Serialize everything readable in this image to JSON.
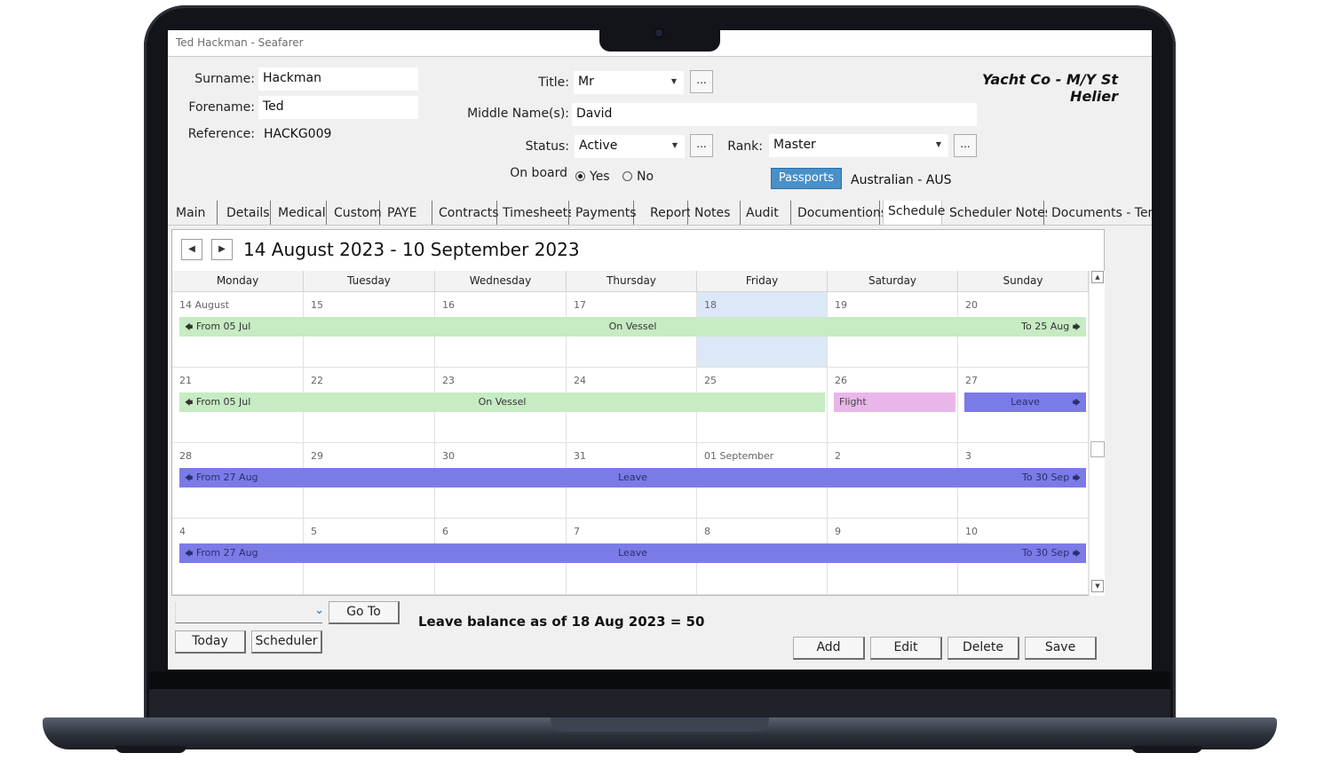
{
  "window": {
    "title": "Ted Hackman - Seafarer"
  },
  "header": {
    "surname_label": "Surname:",
    "surname": "Hackman",
    "forename_label": "Forename:",
    "forename": "Ted",
    "reference_label": "Reference:",
    "reference": "HACKG009",
    "title_label": "Title:",
    "title": "Mr",
    "middle_label": "Middle Name(s):",
    "middle": "David",
    "status_label": "Status:",
    "status": "Active",
    "rank_label": "Rank:",
    "rank": "Master",
    "onboard_label": "On board",
    "yes": "Yes",
    "no": "No",
    "onboard_value": "Yes",
    "company": "Yacht Co - M/Y St Helier",
    "passports_button": "Passports",
    "nationality": "Australian - AUS",
    "ellipsis": "...",
    "dropdown_arrow": "▼"
  },
  "tabs": [
    "Main",
    "Details",
    "Medical",
    "Custom",
    "PAYE",
    "Contracts",
    "Timesheets",
    "Payments",
    "Reports",
    "Notes",
    "Audit",
    "Documentions",
    "Schedule",
    "Scheduler Notes",
    "Documents - Temp"
  ],
  "active_tab": "Schedule",
  "calendar": {
    "prev": "◀",
    "next": "▶",
    "range": "14 August 2023 - 10 September 2023",
    "days": [
      "Monday",
      "Tuesday",
      "Wednesday",
      "Thursday",
      "Friday",
      "Saturday",
      "Sunday"
    ],
    "weeks": [
      {
        "dates": [
          "14 August",
          "15",
          "16",
          "17",
          "18",
          "19",
          "20"
        ]
      },
      {
        "dates": [
          "21",
          "22",
          "23",
          "24",
          "25",
          "26",
          "27"
        ]
      },
      {
        "dates": [
          "28",
          "29",
          "30",
          "31",
          "01 September",
          "2",
          "3"
        ]
      },
      {
        "dates": [
          "4",
          "5",
          "6",
          "7",
          "8",
          "9",
          "10"
        ]
      }
    ],
    "events": {
      "w1_vessel": {
        "from": "From 05 Jul",
        "label": "On Vessel",
        "to": "To 25 Aug"
      },
      "w2_vessel": {
        "from": "From 05 Jul",
        "label": "On Vessel"
      },
      "w2_flight": {
        "label": "Flight"
      },
      "w2_leave": {
        "label": "Leave"
      },
      "w3_leave": {
        "from": "From 27 Aug",
        "label": "Leave",
        "to": "To 30 Sep"
      },
      "w4_leave": {
        "from": "From 27 Aug",
        "label": "Leave",
        "to": "To 30 Sep"
      }
    },
    "highlight_day": "18",
    "colors": {
      "vessel": "#c7ebc3",
      "leave": "#7b7be8",
      "flight": "#e9b6e9",
      "today": "#dce7f8"
    }
  },
  "footer": {
    "goto_button": "Go To",
    "today_button": "Today",
    "scheduler_button": "Scheduler",
    "leave_balance": "Leave balance as of 18 Aug 2023 = 50",
    "add_button": "Add",
    "edit_button": "Edit",
    "delete_button": "Delete",
    "save_button": "Save"
  }
}
